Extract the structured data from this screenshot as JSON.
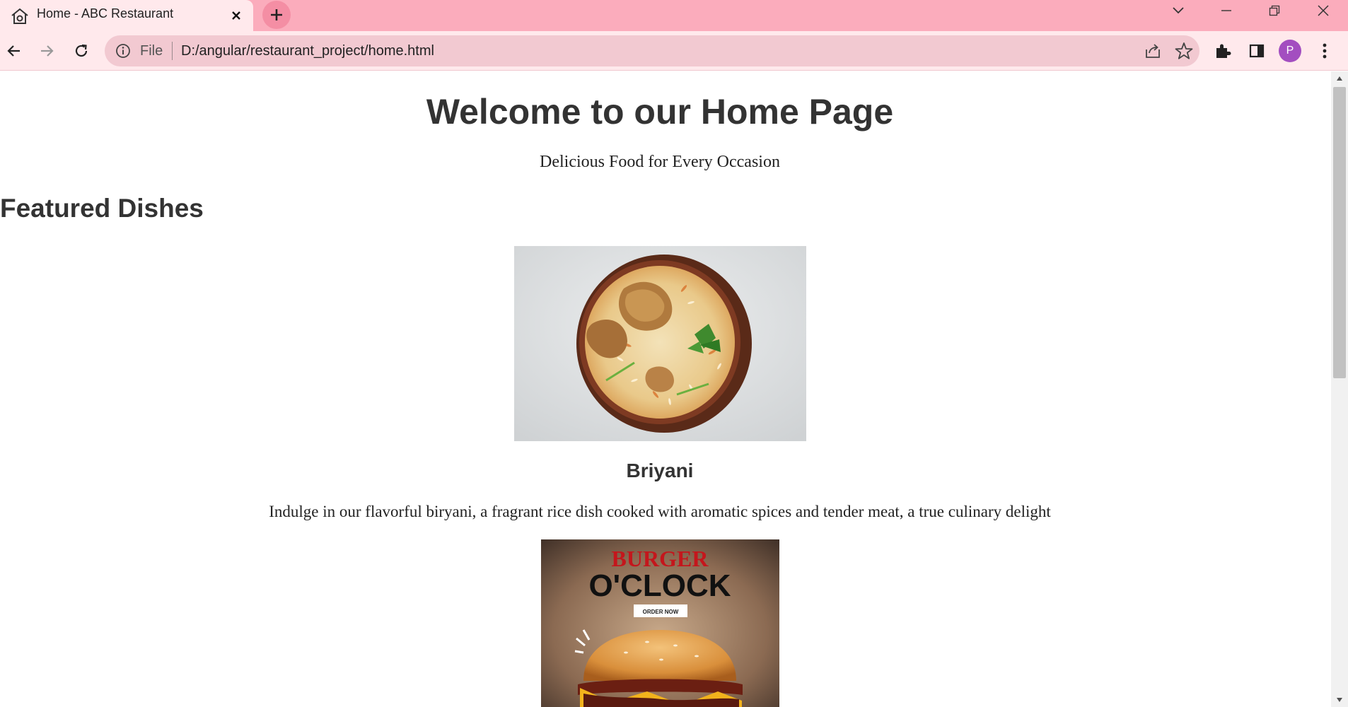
{
  "browser": {
    "tab": {
      "title": "Home - ABC Restaurant"
    },
    "address_bar": {
      "scheme_label": "File",
      "url": "D:/angular/restaurant_project/home.html"
    },
    "profile_initial": "P",
    "colors": {
      "frame": "#fbacbc",
      "toolbar": "#ffe9ec",
      "omnibox": "#f2c9d1",
      "profile": "#a34ec0"
    }
  },
  "page": {
    "heading": "Welcome to our Home Page",
    "tagline": "Delicious Food for Every Occasion",
    "featured_heading": "Featured Dishes",
    "dishes": [
      {
        "name": "Briyani",
        "description": "Indulge in our flavorful biryani, a fragrant rice dish cooked with aromatic spices and tender meat, a true culinary delight"
      },
      {
        "image_text": {
          "line1": "BURGER",
          "line2": "O'CLOCK",
          "button": "ORDER NOW"
        }
      }
    ]
  }
}
